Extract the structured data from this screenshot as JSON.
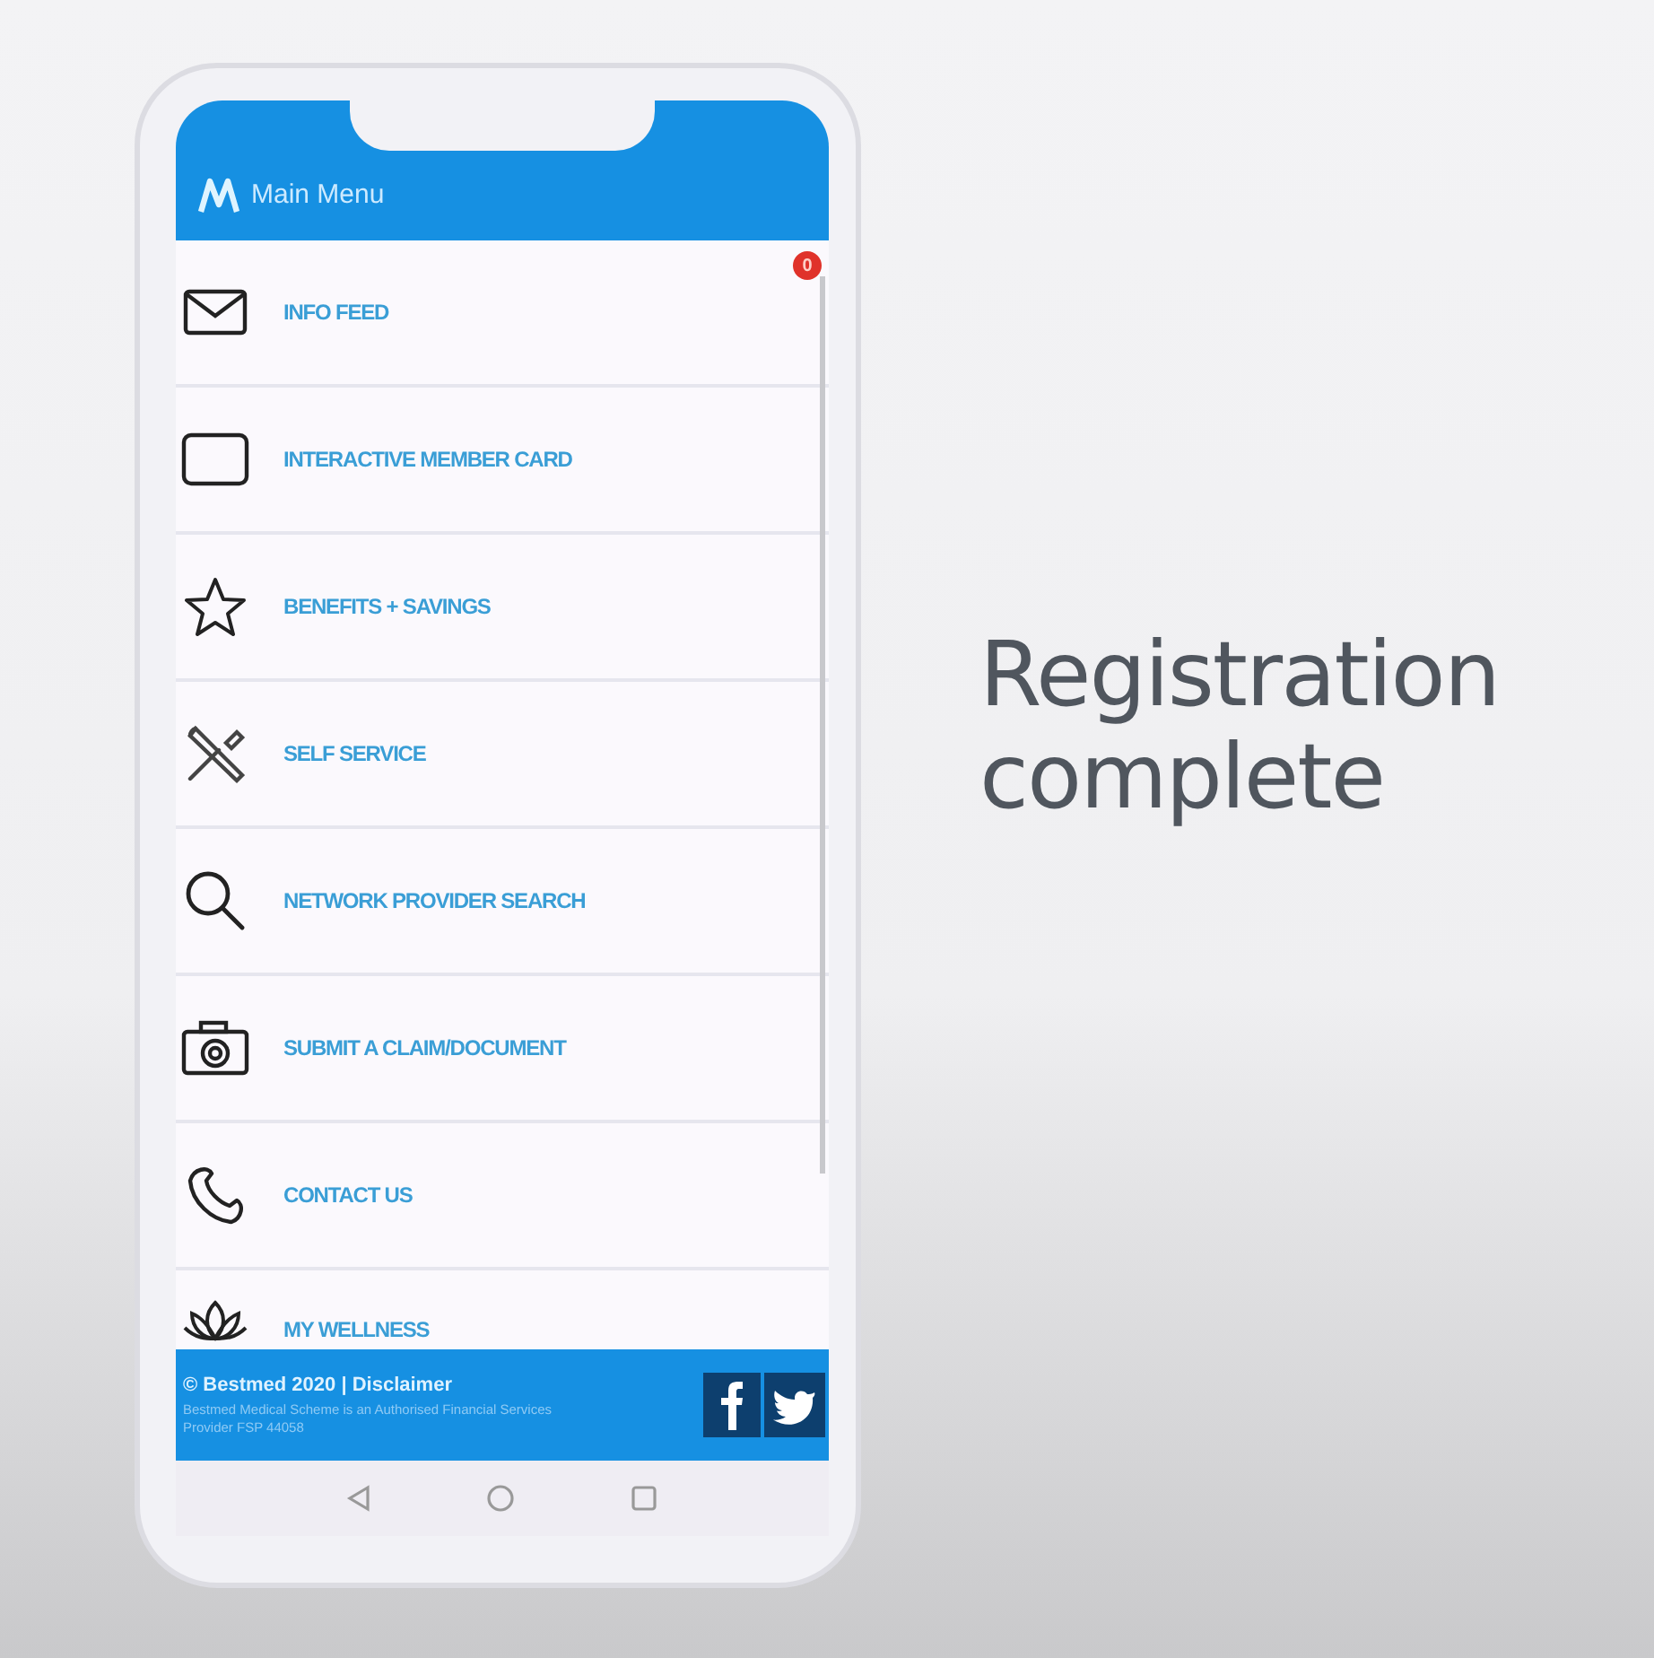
{
  "header": {
    "title": "Main Menu"
  },
  "menu": [
    {
      "label": "INFO FEED",
      "badge": "0"
    },
    {
      "label": "INTERACTIVE MEMBER CARD"
    },
    {
      "label": "BENEFITS + SAVINGS"
    },
    {
      "label": "SELF SERVICE"
    },
    {
      "label": "NETWORK PROVIDER SEARCH"
    },
    {
      "label": "SUBMIT A CLAIM/DOCUMENT"
    },
    {
      "label": "CONTACT US"
    },
    {
      "label": "MY WELLNESS"
    }
  ],
  "footer": {
    "copyright": "© Bestmed 2020 | Disclaimer",
    "note": "Bestmed Medical Scheme is an Authorised Financial Services Provider FSP 44058"
  },
  "caption": "Registration complete"
}
